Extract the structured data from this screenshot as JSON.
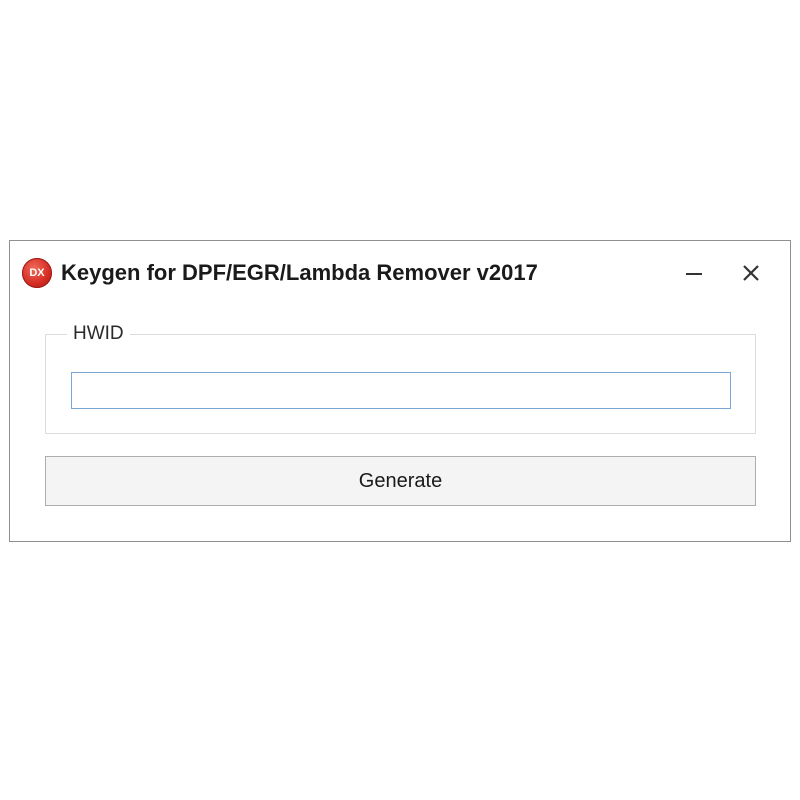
{
  "window": {
    "title": "Keygen for DPF/EGR/Lambda Remover v2017",
    "app_icon_text": "DX",
    "app_icon_color": "#d62f26",
    "controls": {
      "minimize_icon": "minimize-icon",
      "close_icon": "close-icon"
    }
  },
  "hwid": {
    "group_label": "HWID",
    "value": "",
    "placeholder": "",
    "border_color": "#7aa7d6"
  },
  "actions": {
    "generate_label": "Generate"
  }
}
